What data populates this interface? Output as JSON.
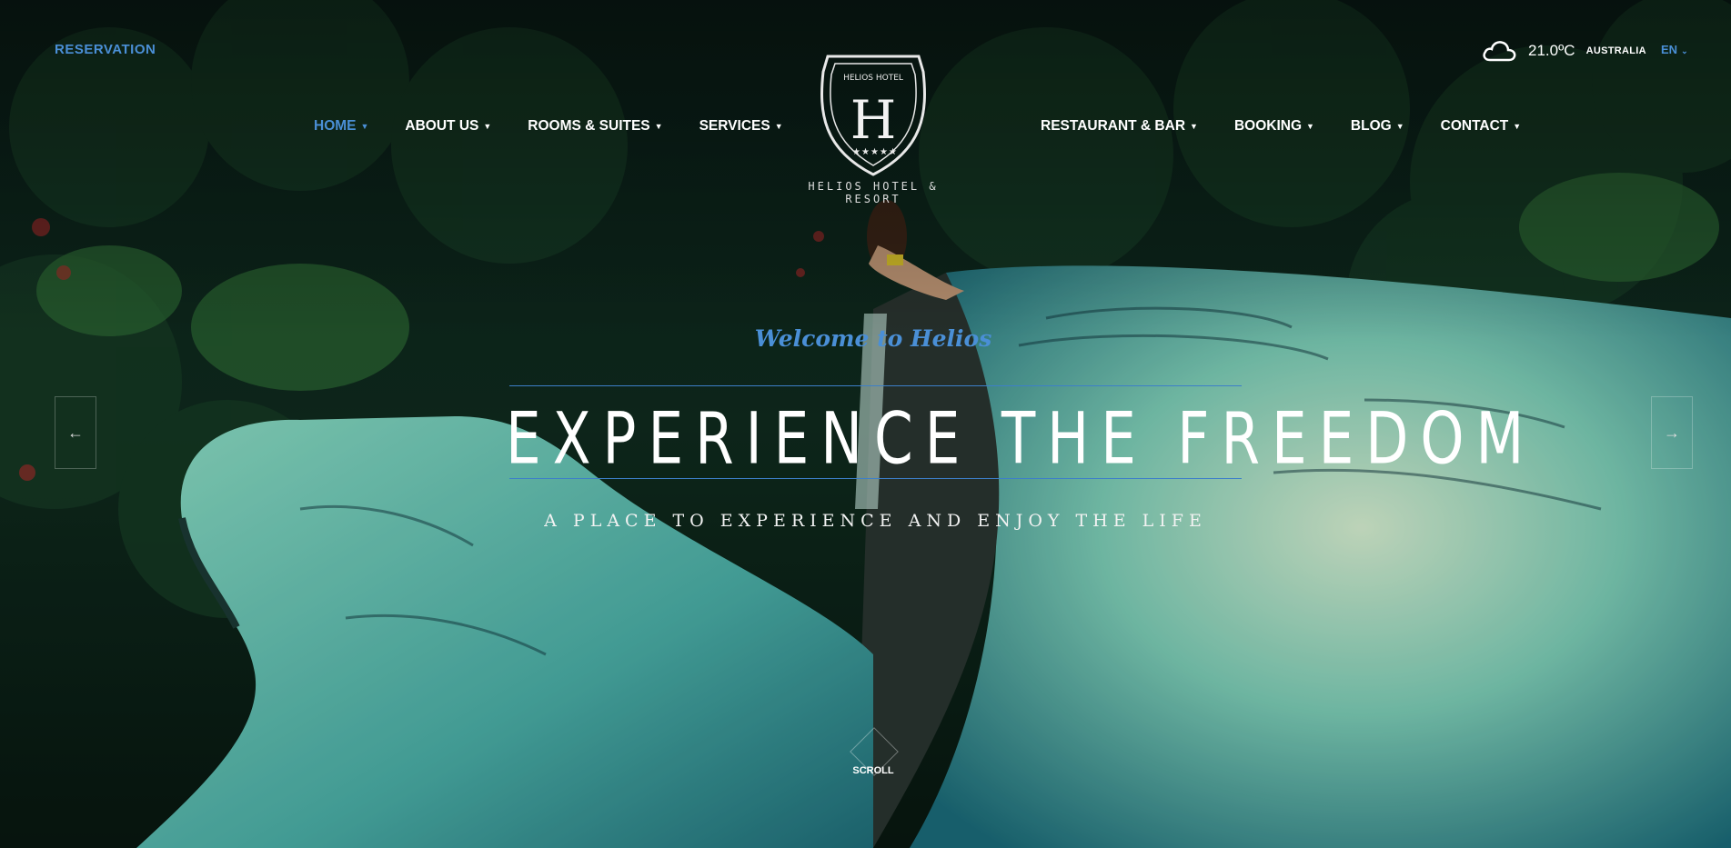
{
  "header": {
    "reservation_label": "RESERVATION",
    "logo_text": "HELIOS HOTEL & RESORT",
    "logo_badge_text": "HELIOS HOTEL",
    "logo_letter": "H"
  },
  "nav_left": [
    {
      "label": "HOME",
      "active": true
    },
    {
      "label": "ABOUT US",
      "active": false
    },
    {
      "label": "ROOMS & SUITES",
      "active": false
    },
    {
      "label": "SERVICES",
      "active": false
    }
  ],
  "nav_right": [
    {
      "label": "RESTAURANT & BAR",
      "active": false
    },
    {
      "label": "BOOKING",
      "active": false
    },
    {
      "label": "BLOG",
      "active": false
    },
    {
      "label": "CONTACT",
      "active": false
    }
  ],
  "weather": {
    "icon": "cloud-icon",
    "temperature": "21.0ºC",
    "location": "AUSTRALIA"
  },
  "language": {
    "selected": "EN"
  },
  "hero": {
    "welcome": "Welcome to Helios",
    "headline": "EXPERIENCE THE FREEDOM",
    "subline": "A PLACE TO EXPERIENCE AND ENJOY THE LIFE",
    "scroll_label": "SCROLL"
  },
  "slider": {
    "prev_icon": "arrow-left-icon",
    "next_icon": "arrow-right-icon"
  },
  "colors": {
    "accent": "#4a8fd6",
    "water": "#6fd6c0",
    "jungle": "#0f2a1c"
  }
}
